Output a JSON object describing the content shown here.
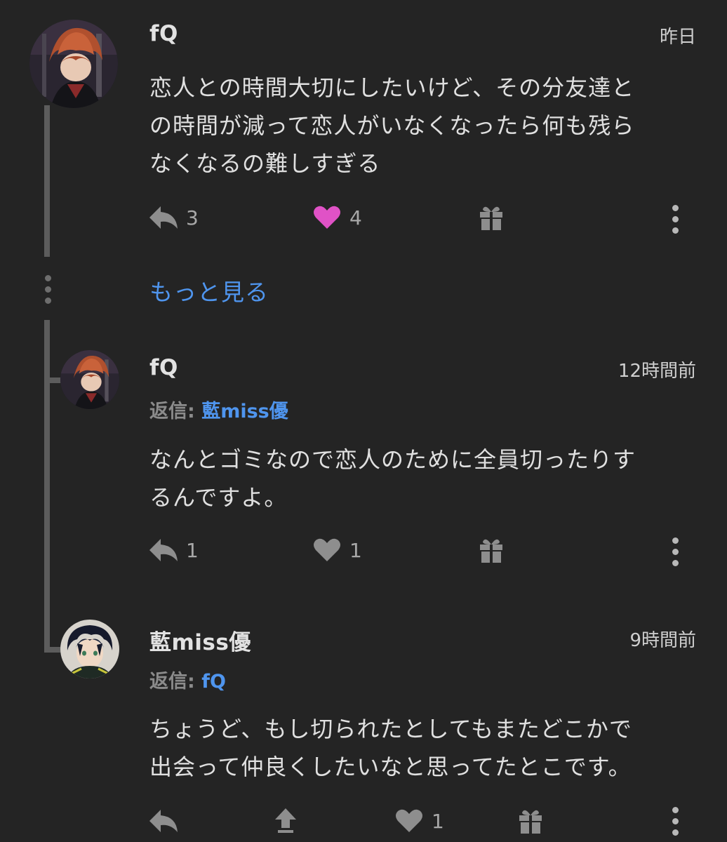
{
  "comments": [
    {
      "username": "fQ",
      "time": "昨日",
      "body_lines": [
        "恋人との時間大切にしたいけど、その分友達と",
        "の時間が減って恋人がいなくなったら何も残ら",
        "なくなるの難しすぎる"
      ],
      "reply_count": "3",
      "like_count": "4",
      "liked": true
    },
    {
      "username": "fQ",
      "time": "12時間前",
      "reply_prefix": "返信:",
      "reply_target": "藍miss優",
      "body_lines": [
        "なんとゴミなので恋人のために全員切ったりす",
        "るんですよ。"
      ],
      "reply_count": "1",
      "like_count": "1",
      "liked": false
    },
    {
      "username": "藍miss優",
      "time": "9時間前",
      "reply_prefix": "返信:",
      "reply_target": "fQ",
      "body_lines": [
        "ちょうど、もし切られたとしてもまたどこかで",
        "出会って仲良くしたいなと思ってたとこです。"
      ],
      "like_count": "1",
      "liked": false
    }
  ],
  "show_more_label": "もっと見る",
  "colors": {
    "background": "#242424",
    "link": "#4f95ee",
    "heart_active": "#e052c6",
    "icon": "#8e8e8e"
  },
  "icons": [
    "reply-icon",
    "heart-icon",
    "gift-icon",
    "more-options-icon",
    "upvote-icon"
  ]
}
